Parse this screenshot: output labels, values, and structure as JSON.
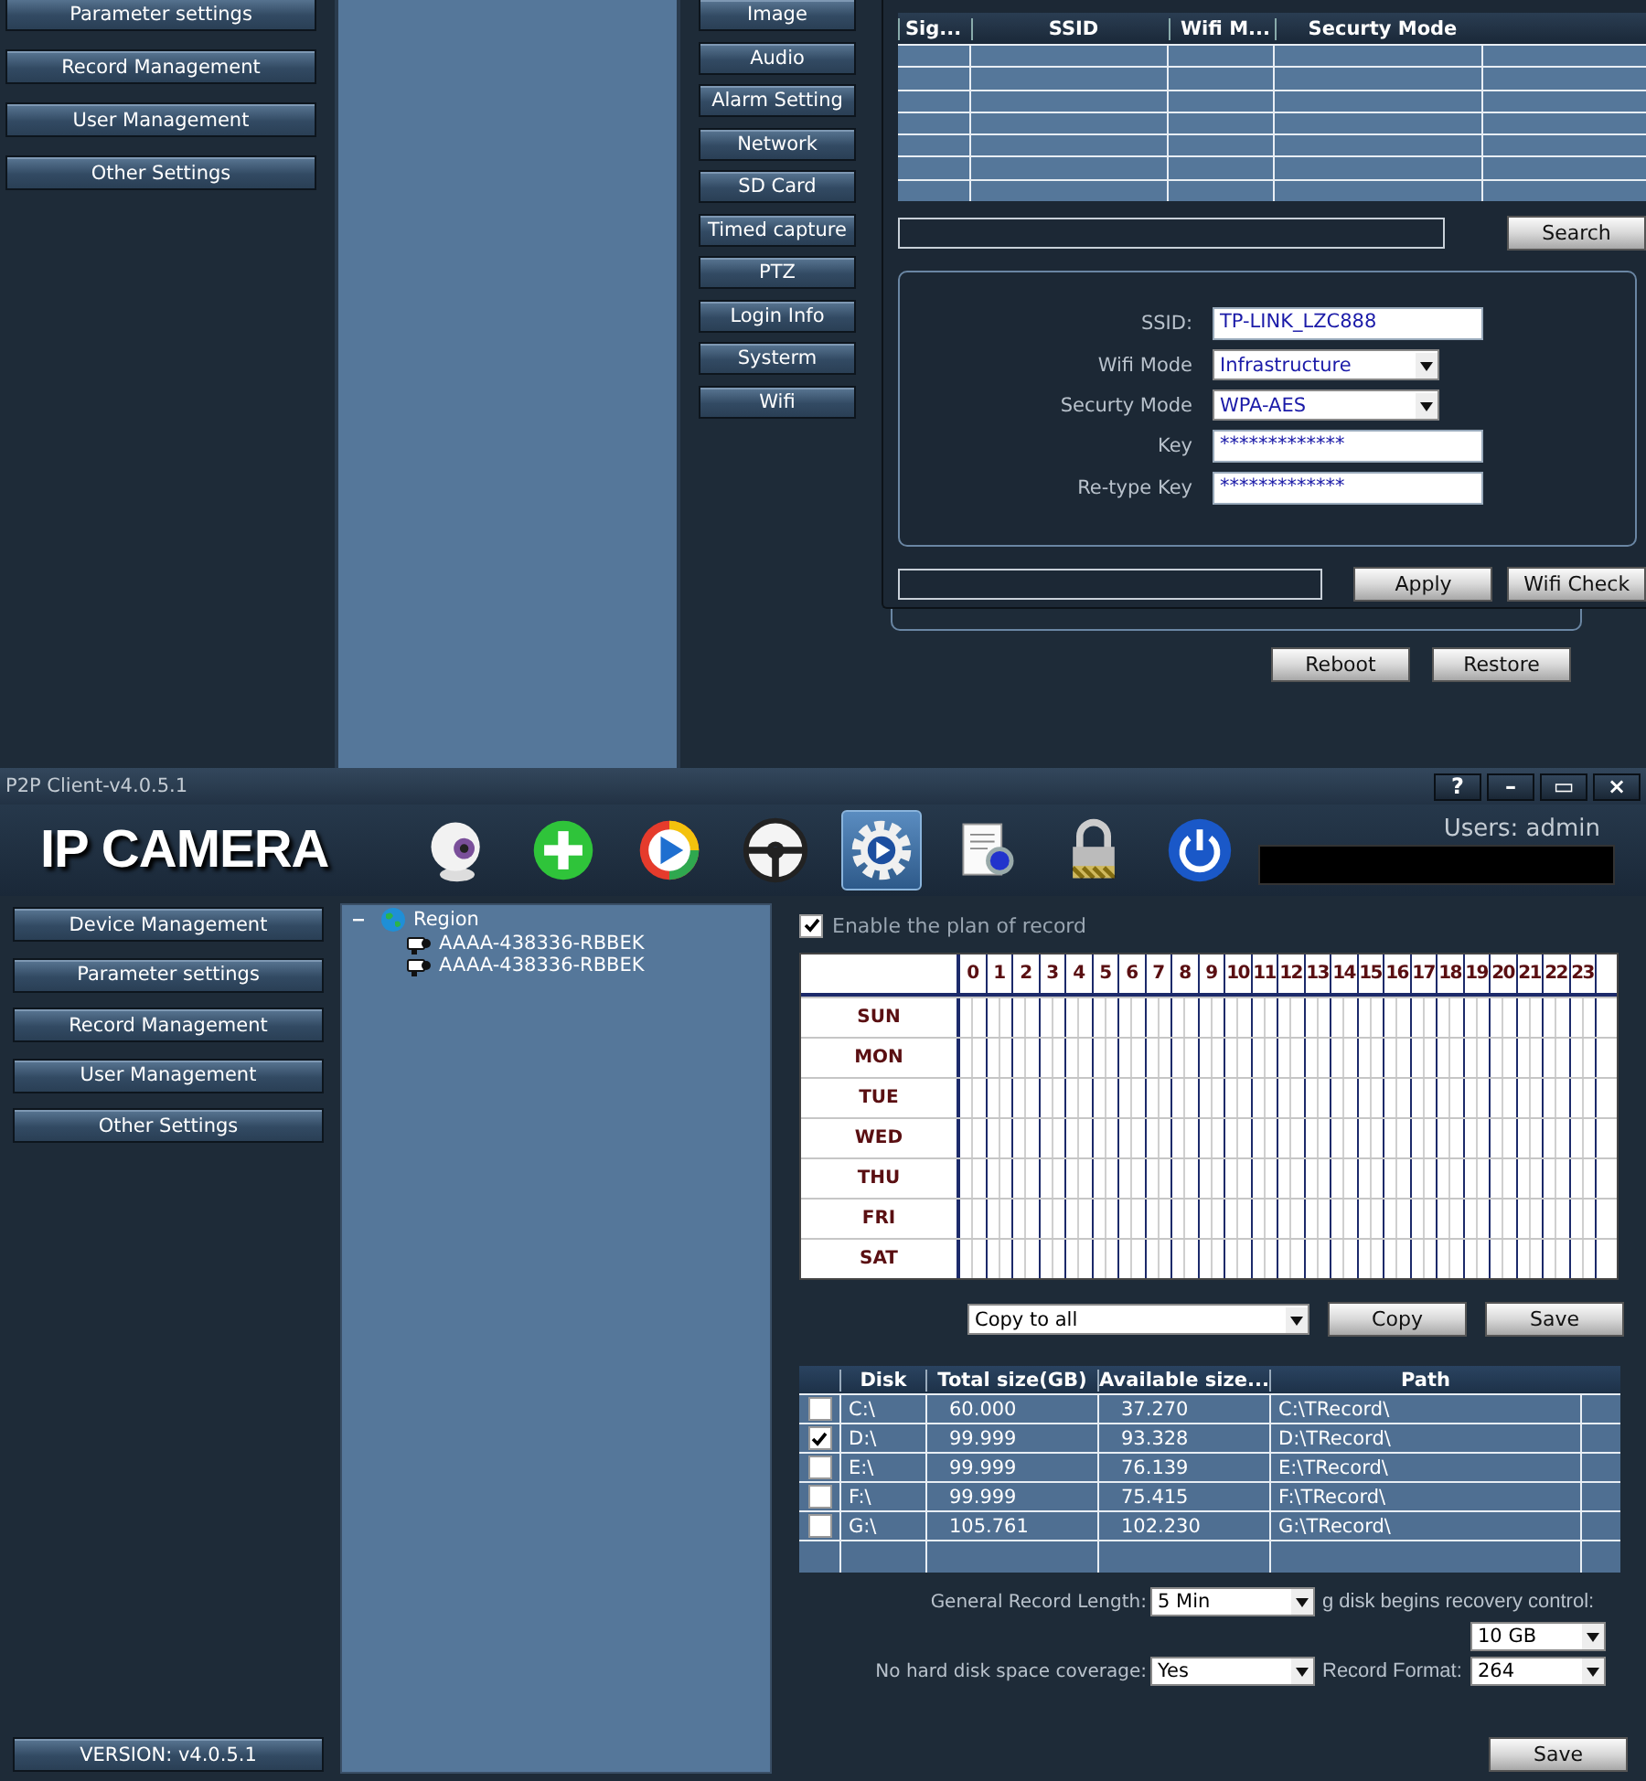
{
  "top_screen": {
    "sidebar": [
      "Parameter settings",
      "Record Management",
      "User Management",
      "Other Settings"
    ],
    "settings_menu": [
      "Image",
      "Audio",
      "Alarm Setting",
      "Network",
      "SD Card",
      "Timed capture",
      "PTZ",
      "Login Info",
      "Systerm",
      "Wifi"
    ],
    "wifi_table": {
      "columns": [
        "Sig...",
        "SSID",
        "Wifi M...",
        "Securty Mode"
      ]
    },
    "search_button": "Search",
    "form": [
      {
        "label": "SSID:",
        "kind": "text",
        "value": "TP-LINK_LZC888"
      },
      {
        "label": "Wifi Mode",
        "kind": "select",
        "value": "Infrastructure"
      },
      {
        "label": "Securty Mode",
        "kind": "select",
        "value": "WPA-AES"
      },
      {
        "label": "Key",
        "kind": "text",
        "value": "*************"
      },
      {
        "label": "Re-type Key",
        "kind": "text",
        "value": "*************"
      }
    ],
    "apply_button": "Apply",
    "check_button": "Wifi Check",
    "reboot_button": "Reboot",
    "restore_button": "Restore"
  },
  "window": {
    "title": "P2P Client-v4.0.5.1",
    "controls": [
      "?",
      "–",
      "▭",
      "×"
    ]
  },
  "logo": "IP CAMERA",
  "toolbar": [
    {
      "kind": "webcam",
      "selected": false
    },
    {
      "kind": "add",
      "selected": false
    },
    {
      "kind": "play",
      "selected": false
    },
    {
      "kind": "wheel",
      "selected": false
    },
    {
      "kind": "settings",
      "selected": true
    },
    {
      "kind": "log",
      "selected": false
    },
    {
      "kind": "lock",
      "selected": false
    },
    {
      "kind": "power",
      "selected": false
    }
  ],
  "user": "Users: admin",
  "sidebar": [
    "Device Management",
    "Parameter settings",
    "Record Management",
    "User Management",
    "Other Settings"
  ],
  "version": "VERSION: v4.0.5.1",
  "tree": {
    "label": "Region",
    "expanded": true,
    "children": [
      {
        "label": "AAAA-438336-RBBEK"
      },
      {
        "label": "AAAA-438336-RBBEK"
      }
    ]
  },
  "record_plan": {
    "enable_label": "Enable the plan of record",
    "enabled": true,
    "hours": [
      "0",
      "1",
      "2",
      "3",
      "4",
      "5",
      "6",
      "7",
      "8",
      "9",
      "10",
      "11",
      "12",
      "13",
      "14",
      "15",
      "16",
      "17",
      "18",
      "19",
      "20",
      "21",
      "22",
      "23"
    ],
    "days": [
      "SUN",
      "MON",
      "TUE",
      "WED",
      "THU",
      "FRI",
      "SAT"
    ],
    "copy_select": "Copy to all",
    "copy_button": "Copy",
    "save_button": "Save"
  },
  "disks": {
    "columns": [
      "Disk",
      "Total size(GB)",
      "Available size...",
      "Path"
    ],
    "rows": [
      {
        "checked": false,
        "disk": "C:\\",
        "total": "60.000",
        "available": "37.270",
        "path": "C:\\TRecord\\"
      },
      {
        "checked": true,
        "disk": "D:\\",
        "total": "99.999",
        "available": "93.328",
        "path": "D:\\TRecord\\"
      },
      {
        "checked": false,
        "disk": "E:\\",
        "total": "99.999",
        "available": "76.139",
        "path": "E:\\TRecord\\"
      },
      {
        "checked": false,
        "disk": "F:\\",
        "total": "99.999",
        "available": "75.415",
        "path": "F:\\TRecord\\"
      },
      {
        "checked": false,
        "disk": "G:\\",
        "total": "105.761",
        "available": "102.230",
        "path": "G:\\TRecord\\"
      }
    ]
  },
  "options": {
    "record_length_label": "General Record Length:",
    "record_length": "5 Min",
    "recovery_label": "g disk begins recovery control:",
    "recovery": "10 GB",
    "coverage_label": "No hard disk space coverage:",
    "coverage": "Yes",
    "format_label": "Record Format:",
    "format": "264",
    "save_button": "Save"
  }
}
